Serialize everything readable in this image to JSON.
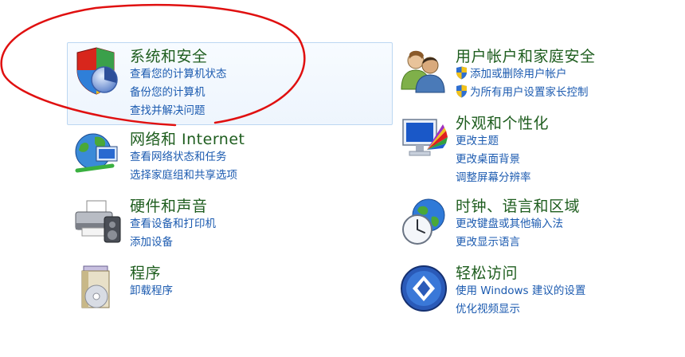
{
  "categories": [
    {
      "id": "system-security",
      "title": "系统和安全",
      "icon": "shield-pie-icon",
      "links": [
        "查看您的计算机状态",
        "备份您的计算机",
        "查找并解决问题"
      ]
    },
    {
      "id": "user-accounts",
      "title": "用户帐户和家庭安全",
      "icon": "users-icon",
      "links": [
        "添加或删除用户帐户",
        "为所有用户设置家长控制"
      ],
      "link_icons": [
        "uac-shield-icon",
        "uac-shield-icon"
      ]
    },
    {
      "id": "network",
      "title": "网络和 Internet",
      "icon": "globe-network-icon",
      "links": [
        "查看网络状态和任务",
        "选择家庭组和共享选项"
      ]
    },
    {
      "id": "appearance",
      "title": "外观和个性化",
      "icon": "monitor-palette-icon",
      "links": [
        "更改主题",
        "更改桌面背景",
        "调整屏幕分辨率"
      ]
    },
    {
      "id": "hardware",
      "title": "硬件和声音",
      "icon": "printer-speaker-icon",
      "links": [
        "查看设备和打印机",
        "添加设备"
      ]
    },
    {
      "id": "clock",
      "title": "时钟、语言和区域",
      "icon": "clock-globe-icon",
      "links": [
        "更改键盘或其他输入法",
        "更改显示语言"
      ]
    },
    {
      "id": "programs",
      "title": "程序",
      "icon": "programs-disc-icon",
      "links": [
        "卸载程序"
      ]
    },
    {
      "id": "ease",
      "title": "轻松访问",
      "icon": "ease-of-access-icon",
      "links": [
        "使用 Windows 建议的设置",
        "优化视频显示"
      ]
    }
  ],
  "colors": {
    "title_green": "#1e5d1e",
    "link_blue": "#1c5bb0",
    "hover_border": "#bcd7f2",
    "annotation_red": "#e01010"
  }
}
